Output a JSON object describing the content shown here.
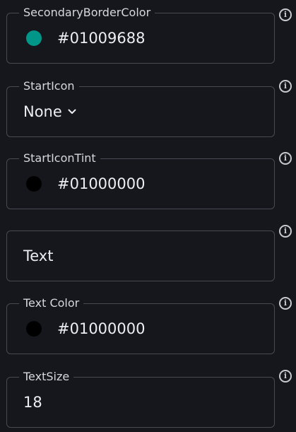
{
  "fields": [
    {
      "label": "SecondaryBorderColor",
      "value": "#01009688",
      "swatch_color": "#009688",
      "icon": "info-icon"
    },
    {
      "label": "StartIcon",
      "value": "None",
      "icon": "info-icon"
    },
    {
      "label": "StartIconTint",
      "value": "#01000000",
      "swatch_color": "#000000",
      "icon": "info-icon"
    },
    {
      "label": "",
      "value": "Text",
      "icon": "info-icon"
    },
    {
      "label": "Text Color",
      "value": "#01000000",
      "swatch_color": "#000000",
      "icon": "info-icon"
    },
    {
      "label": "TextSize",
      "value": "18",
      "icon": "info-icon"
    }
  ]
}
